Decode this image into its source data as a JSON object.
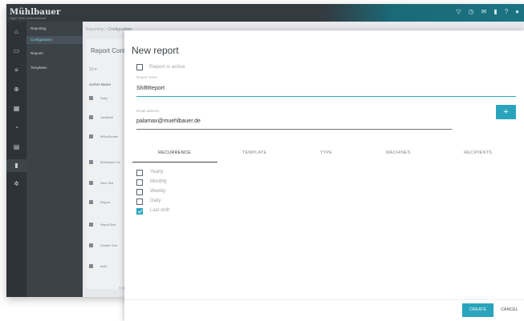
{
  "app": {
    "logo": "Mühlbauer",
    "logo_sub": "High Tech International"
  },
  "topbar_icons": [
    "filter-icon",
    "clock-icon",
    "mail-icon",
    "bell-icon",
    "help-icon",
    "user-icon"
  ],
  "rail_icons": [
    "home-icon",
    "monitor-icon",
    "list-icon",
    "target-icon",
    "calendar-icon",
    "time-icon",
    "grid-icon",
    "document-icon",
    "gear-icon"
  ],
  "subnav": {
    "title": "Reporting",
    "items": [
      "Configuration",
      "Reports",
      "Templates"
    ]
  },
  "breadcrumb": {
    "root": "Reporting",
    "sep": ">",
    "current": "Configuration"
  },
  "list_card": {
    "title": "Report Configuration",
    "per_page": "10",
    "headers": {
      "active": "Active",
      "name": "Name"
    },
    "rows": [
      "Daily",
      "JuniNeW",
      "MRepDelete",
      "Mühlbauer Us",
      "New Test",
      "Report",
      "ReportTest",
      "Shuttle Test",
      "test1"
    ],
    "footnote": "© M"
  },
  "dialog": {
    "title": "New report",
    "active_label": "Report is active",
    "report_name_label": "Report name",
    "report_name_value": "ShiftReport",
    "email_label": "Email address",
    "email_value": "palamax@muehlbauer.de",
    "add_label": "+",
    "tabs": [
      "RECURRENCE",
      "TEMPLATE",
      "TYPE",
      "MACHINES",
      "RECIPIENTS"
    ],
    "recurrence_options": [
      {
        "label": "Yearly",
        "checked": false
      },
      {
        "label": "Monthly",
        "checked": false
      },
      {
        "label": "Weekly",
        "checked": false
      },
      {
        "label": "Daily",
        "checked": false
      },
      {
        "label": "Last shift",
        "checked": true
      }
    ],
    "create_label": "CREATE",
    "cancel_label": "CANCEL"
  },
  "colors": {
    "accent": "#2aa4bc",
    "topbar": "#333a40",
    "sidebar": "#2d3338"
  }
}
